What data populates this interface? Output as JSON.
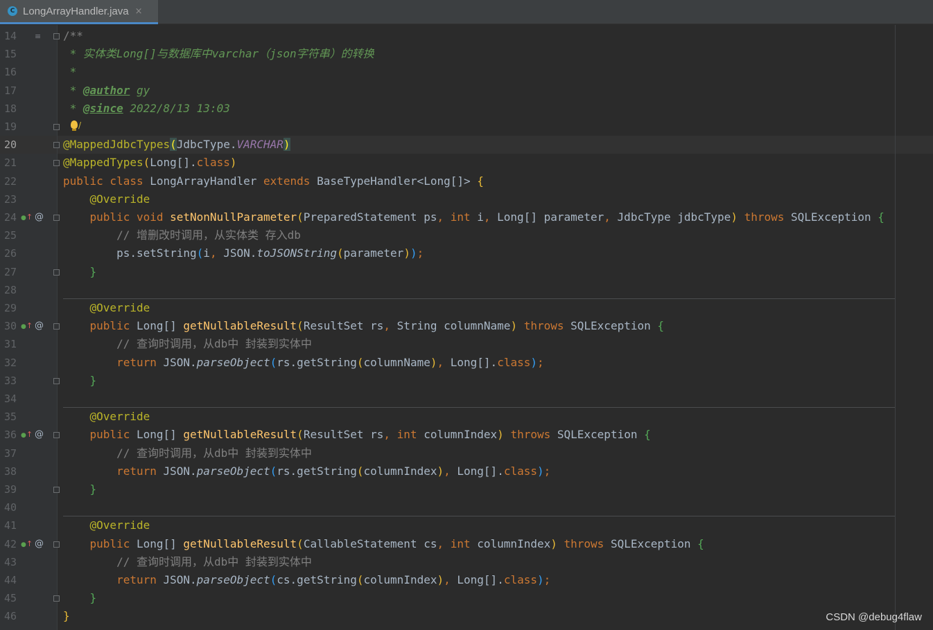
{
  "tab": {
    "label": "LongArrayHandler.java",
    "icon": "java-class-icon",
    "icon_letter": "C",
    "close": "×"
  },
  "gutter_icons": {
    "override": "override-implements-icon",
    "annotation": "annotation-icon",
    "fold": "fold-icon",
    "doc_toggle": "doc-render-icon",
    "intention": "lightbulb-icon"
  },
  "current_line": "20",
  "lines": [
    {
      "n": "14",
      "segs": [
        [
          "cm",
          "/**"
        ]
      ]
    },
    {
      "n": "15",
      "segs": [
        [
          "doc",
          " * 实体类Long[]与数据库中varchar（json字符串）的转换"
        ]
      ]
    },
    {
      "n": "16",
      "segs": [
        [
          "doc",
          " *"
        ]
      ]
    },
    {
      "n": "17",
      "segs": [
        [
          "doc",
          " * "
        ],
        [
          "doctag",
          "@author"
        ],
        [
          "doc",
          " gy"
        ]
      ]
    },
    {
      "n": "18",
      "segs": [
        [
          "doc",
          " * "
        ],
        [
          "doctag",
          "@since"
        ],
        [
          "doc",
          " 2022/8/13 13:03"
        ]
      ]
    },
    {
      "n": "19",
      "segs": [
        [
          "doc",
          " "
        ]
      ]
    },
    {
      "n": "20",
      "segs": [
        [
          "an",
          "@MappedJdbcTypes"
        ],
        [
          "pr-hl",
          "("
        ],
        [
          "",
          "JdbcType."
        ],
        [
          "cst",
          "VARCHAR"
        ],
        [
          "pr-hl",
          ")"
        ]
      ]
    },
    {
      "n": "21",
      "segs": [
        [
          "an",
          "@MappedTypes"
        ],
        [
          "pr-y",
          "("
        ],
        [
          "",
          "Long[]."
        ],
        [
          "kw",
          "class"
        ],
        [
          "pr-y",
          ")"
        ]
      ]
    },
    {
      "n": "22",
      "segs": [
        [
          "kw",
          "public class "
        ],
        [
          "",
          "LongArrayHandler "
        ],
        [
          "kw",
          "extends "
        ],
        [
          "",
          "BaseTypeHandler<Long[]> "
        ],
        [
          "pr-y",
          "{"
        ]
      ]
    },
    {
      "n": "23",
      "segs": [
        [
          "",
          "    "
        ],
        [
          "an",
          "@Override"
        ]
      ]
    },
    {
      "n": "24",
      "segs": [
        [
          "",
          "    "
        ],
        [
          "kw",
          "public void "
        ],
        [
          "fn",
          "setNonNullParameter"
        ],
        [
          "pr-y",
          "("
        ],
        [
          "",
          "PreparedStatement ps"
        ],
        [
          "kw",
          ", int "
        ],
        [
          "",
          "i"
        ],
        [
          "kw",
          ", "
        ],
        [
          "",
          "Long[] parameter"
        ],
        [
          "kw",
          ", "
        ],
        [
          "",
          "JdbcType jdbcType"
        ],
        [
          "pr-y",
          ")"
        ],
        [
          "kw",
          " throws "
        ],
        [
          "",
          "SQLException "
        ],
        [
          "pr-g",
          "{"
        ]
      ]
    },
    {
      "n": "25",
      "segs": [
        [
          "",
          "        "
        ],
        [
          "cm",
          "// 增删改时调用，从实体类 存入db"
        ]
      ]
    },
    {
      "n": "26",
      "segs": [
        [
          "",
          "        ps.setString"
        ],
        [
          "pr-b",
          "("
        ],
        [
          "",
          "i"
        ],
        [
          "kw",
          ", "
        ],
        [
          "",
          "JSON."
        ],
        [
          "it",
          "toJSONString"
        ],
        [
          "pr-y",
          "("
        ],
        [
          "",
          "parameter"
        ],
        [
          "pr-y",
          ")"
        ],
        [
          "pr-b",
          ")"
        ],
        [
          "kw",
          ";"
        ]
      ]
    },
    {
      "n": "27",
      "segs": [
        [
          "",
          "    "
        ],
        [
          "pr-g",
          "}"
        ]
      ]
    },
    {
      "n": "28",
      "segs": []
    },
    {
      "n": "29",
      "segs": [
        [
          "",
          "    "
        ],
        [
          "an",
          "@Override"
        ]
      ]
    },
    {
      "n": "30",
      "segs": [
        [
          "",
          "    "
        ],
        [
          "kw",
          "public "
        ],
        [
          "",
          "Long[] "
        ],
        [
          "fn",
          "getNullableResult"
        ],
        [
          "pr-y",
          "("
        ],
        [
          "",
          "ResultSet rs"
        ],
        [
          "kw",
          ", "
        ],
        [
          "",
          "String columnName"
        ],
        [
          "pr-y",
          ")"
        ],
        [
          "kw",
          " throws "
        ],
        [
          "",
          "SQLException "
        ],
        [
          "pr-g",
          "{"
        ]
      ]
    },
    {
      "n": "31",
      "segs": [
        [
          "",
          "        "
        ],
        [
          "cm",
          "// 查询时调用，从db中 封装到实体中"
        ]
      ]
    },
    {
      "n": "32",
      "segs": [
        [
          "",
          "        "
        ],
        [
          "kw",
          "return "
        ],
        [
          "",
          "JSON."
        ],
        [
          "it",
          "parseObject"
        ],
        [
          "pr-b",
          "("
        ],
        [
          "",
          "rs.getString"
        ],
        [
          "pr-y",
          "("
        ],
        [
          "",
          "columnName"
        ],
        [
          "pr-y",
          ")"
        ],
        [
          "kw",
          ", "
        ],
        [
          "",
          "Long[]."
        ],
        [
          "kw",
          "class"
        ],
        [
          "pr-b",
          ")"
        ],
        [
          "kw",
          ";"
        ]
      ]
    },
    {
      "n": "33",
      "segs": [
        [
          "",
          "    "
        ],
        [
          "pr-g",
          "}"
        ]
      ]
    },
    {
      "n": "34",
      "segs": []
    },
    {
      "n": "35",
      "segs": [
        [
          "",
          "    "
        ],
        [
          "an",
          "@Override"
        ]
      ]
    },
    {
      "n": "36",
      "segs": [
        [
          "",
          "    "
        ],
        [
          "kw",
          "public "
        ],
        [
          "",
          "Long[] "
        ],
        [
          "fn",
          "getNullableResult"
        ],
        [
          "pr-y",
          "("
        ],
        [
          "",
          "ResultSet rs"
        ],
        [
          "kw",
          ", int "
        ],
        [
          "",
          "columnIndex"
        ],
        [
          "pr-y",
          ")"
        ],
        [
          "kw",
          " throws "
        ],
        [
          "",
          "SQLException "
        ],
        [
          "pr-g",
          "{"
        ]
      ]
    },
    {
      "n": "37",
      "segs": [
        [
          "",
          "        "
        ],
        [
          "cm",
          "// 查询时调用，从db中 封装到实体中"
        ]
      ]
    },
    {
      "n": "38",
      "segs": [
        [
          "",
          "        "
        ],
        [
          "kw",
          "return "
        ],
        [
          "",
          "JSON."
        ],
        [
          "it",
          "parseObject"
        ],
        [
          "pr-b",
          "("
        ],
        [
          "",
          "rs.getString"
        ],
        [
          "pr-y",
          "("
        ],
        [
          "",
          "columnIndex"
        ],
        [
          "pr-y",
          ")"
        ],
        [
          "kw",
          ", "
        ],
        [
          "",
          "Long[]."
        ],
        [
          "kw",
          "class"
        ],
        [
          "pr-b",
          ")"
        ],
        [
          "kw",
          ";"
        ]
      ]
    },
    {
      "n": "39",
      "segs": [
        [
          "",
          "    "
        ],
        [
          "pr-g",
          "}"
        ]
      ]
    },
    {
      "n": "40",
      "segs": []
    },
    {
      "n": "41",
      "segs": [
        [
          "",
          "    "
        ],
        [
          "an",
          "@Override"
        ]
      ]
    },
    {
      "n": "42",
      "segs": [
        [
          "",
          "    "
        ],
        [
          "kw",
          "public "
        ],
        [
          "",
          "Long[] "
        ],
        [
          "fn",
          "getNullableResult"
        ],
        [
          "pr-y",
          "("
        ],
        [
          "",
          "CallableStatement cs"
        ],
        [
          "kw",
          ", int "
        ],
        [
          "",
          "columnIndex"
        ],
        [
          "pr-y",
          ")"
        ],
        [
          "kw",
          " throws "
        ],
        [
          "",
          "SQLException "
        ],
        [
          "pr-g",
          "{"
        ]
      ]
    },
    {
      "n": "43",
      "segs": [
        [
          "",
          "        "
        ],
        [
          "cm",
          "// 查询时调用，从db中 封装到实体中"
        ]
      ]
    },
    {
      "n": "44",
      "segs": [
        [
          "",
          "        "
        ],
        [
          "kw",
          "return "
        ],
        [
          "",
          "JSON."
        ],
        [
          "it",
          "parseObject"
        ],
        [
          "pr-b",
          "("
        ],
        [
          "",
          "cs.getString"
        ],
        [
          "pr-y",
          "("
        ],
        [
          "",
          "columnIndex"
        ],
        [
          "pr-y",
          ")"
        ],
        [
          "kw",
          ", "
        ],
        [
          "",
          "Long[]."
        ],
        [
          "kw",
          "class"
        ],
        [
          "pr-b",
          ")"
        ],
        [
          "kw",
          ";"
        ]
      ]
    },
    {
      "n": "45",
      "segs": [
        [
          "",
          "    "
        ],
        [
          "pr-g",
          "}"
        ]
      ]
    },
    {
      "n": "46",
      "segs": [
        [
          "pr-y",
          "}"
        ]
      ]
    }
  ],
  "override_lines": [
    "24",
    "30",
    "36",
    "42"
  ],
  "fold_lines": [
    "14",
    "19",
    "20",
    "21",
    "24",
    "27",
    "30",
    "33",
    "36",
    "39",
    "42",
    "45"
  ],
  "watermark": "CSDN @debug4flaw"
}
